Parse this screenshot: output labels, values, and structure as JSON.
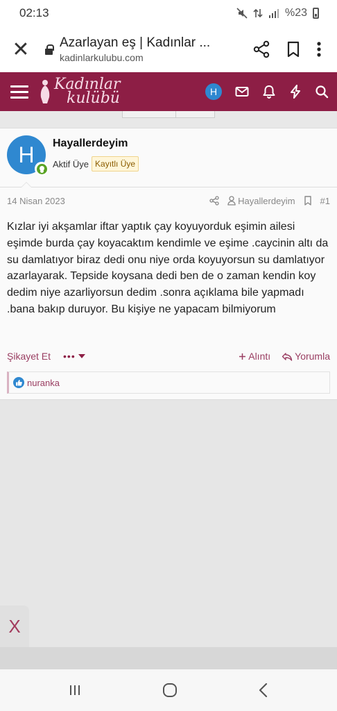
{
  "status_bar": {
    "time": "02:13",
    "battery": "%23"
  },
  "browser": {
    "title": "Azarlayan eş | Kadınlar ...",
    "domain": "kadinlarkulubu.com",
    "close_icon": "close-icon",
    "share_icon": "share-icon",
    "bookmark_icon": "bookmark-icon",
    "menu_icon": "more-vert-icon"
  },
  "site_header": {
    "logo_line1": "Kadınlar",
    "logo_line2": "kulübü",
    "avatar_letter": "H",
    "brand_color": "#8d1e45"
  },
  "post": {
    "avatar_letter": "H",
    "username": "Hayallerdeyim",
    "user_title": "Aktif Üye",
    "user_badge": "Kayıtlı Üye",
    "date": "14 Nisan 2023",
    "author": "Hayallerdeyim",
    "post_number": "#1",
    "body": "Kızlar iyi akşamlar iftar yaptık çay koyuyorduk eşimin ailesi eşimde burda çay koyacaktım kendimle ve eşime .caycinin altı da su damlatıyor biraz dedi onu niye orda koyuyorsun su damlatıyor azarlayarak. Tepside koysana dedi ben de o zaman kendin koy dedim niye azarliyorsun dedim .sonra açıklama bile yapmadı .bana bakıp duruyor. Bu kişiye ne yapacam bilmiyorum",
    "report_label": "Şikayet Et",
    "more_label": "•••",
    "quote_label": "Alıntı",
    "reply_label": "Yorumla",
    "reaction_user": "nuranka"
  },
  "overlay": {
    "close_label": "X"
  }
}
